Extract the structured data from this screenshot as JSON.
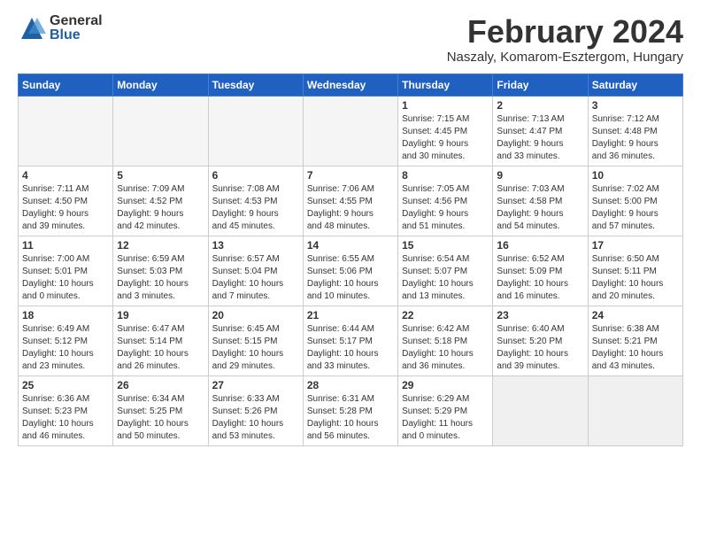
{
  "logo": {
    "general": "General",
    "blue": "Blue"
  },
  "title": "February 2024",
  "subtitle": "Naszaly, Komarom-Esztergom, Hungary",
  "days_header": [
    "Sunday",
    "Monday",
    "Tuesday",
    "Wednesday",
    "Thursday",
    "Friday",
    "Saturday"
  ],
  "weeks": [
    [
      {
        "day": "",
        "info": ""
      },
      {
        "day": "",
        "info": ""
      },
      {
        "day": "",
        "info": ""
      },
      {
        "day": "",
        "info": ""
      },
      {
        "day": "1",
        "info": "Sunrise: 7:15 AM\nSunset: 4:45 PM\nDaylight: 9 hours\nand 30 minutes."
      },
      {
        "day": "2",
        "info": "Sunrise: 7:13 AM\nSunset: 4:47 PM\nDaylight: 9 hours\nand 33 minutes."
      },
      {
        "day": "3",
        "info": "Sunrise: 7:12 AM\nSunset: 4:48 PM\nDaylight: 9 hours\nand 36 minutes."
      }
    ],
    [
      {
        "day": "4",
        "info": "Sunrise: 7:11 AM\nSunset: 4:50 PM\nDaylight: 9 hours\nand 39 minutes."
      },
      {
        "day": "5",
        "info": "Sunrise: 7:09 AM\nSunset: 4:52 PM\nDaylight: 9 hours\nand 42 minutes."
      },
      {
        "day": "6",
        "info": "Sunrise: 7:08 AM\nSunset: 4:53 PM\nDaylight: 9 hours\nand 45 minutes."
      },
      {
        "day": "7",
        "info": "Sunrise: 7:06 AM\nSunset: 4:55 PM\nDaylight: 9 hours\nand 48 minutes."
      },
      {
        "day": "8",
        "info": "Sunrise: 7:05 AM\nSunset: 4:56 PM\nDaylight: 9 hours\nand 51 minutes."
      },
      {
        "day": "9",
        "info": "Sunrise: 7:03 AM\nSunset: 4:58 PM\nDaylight: 9 hours\nand 54 minutes."
      },
      {
        "day": "10",
        "info": "Sunrise: 7:02 AM\nSunset: 5:00 PM\nDaylight: 9 hours\nand 57 minutes."
      }
    ],
    [
      {
        "day": "11",
        "info": "Sunrise: 7:00 AM\nSunset: 5:01 PM\nDaylight: 10 hours\nand 0 minutes."
      },
      {
        "day": "12",
        "info": "Sunrise: 6:59 AM\nSunset: 5:03 PM\nDaylight: 10 hours\nand 3 minutes."
      },
      {
        "day": "13",
        "info": "Sunrise: 6:57 AM\nSunset: 5:04 PM\nDaylight: 10 hours\nand 7 minutes."
      },
      {
        "day": "14",
        "info": "Sunrise: 6:55 AM\nSunset: 5:06 PM\nDaylight: 10 hours\nand 10 minutes."
      },
      {
        "day": "15",
        "info": "Sunrise: 6:54 AM\nSunset: 5:07 PM\nDaylight: 10 hours\nand 13 minutes."
      },
      {
        "day": "16",
        "info": "Sunrise: 6:52 AM\nSunset: 5:09 PM\nDaylight: 10 hours\nand 16 minutes."
      },
      {
        "day": "17",
        "info": "Sunrise: 6:50 AM\nSunset: 5:11 PM\nDaylight: 10 hours\nand 20 minutes."
      }
    ],
    [
      {
        "day": "18",
        "info": "Sunrise: 6:49 AM\nSunset: 5:12 PM\nDaylight: 10 hours\nand 23 minutes."
      },
      {
        "day": "19",
        "info": "Sunrise: 6:47 AM\nSunset: 5:14 PM\nDaylight: 10 hours\nand 26 minutes."
      },
      {
        "day": "20",
        "info": "Sunrise: 6:45 AM\nSunset: 5:15 PM\nDaylight: 10 hours\nand 29 minutes."
      },
      {
        "day": "21",
        "info": "Sunrise: 6:44 AM\nSunset: 5:17 PM\nDaylight: 10 hours\nand 33 minutes."
      },
      {
        "day": "22",
        "info": "Sunrise: 6:42 AM\nSunset: 5:18 PM\nDaylight: 10 hours\nand 36 minutes."
      },
      {
        "day": "23",
        "info": "Sunrise: 6:40 AM\nSunset: 5:20 PM\nDaylight: 10 hours\nand 39 minutes."
      },
      {
        "day": "24",
        "info": "Sunrise: 6:38 AM\nSunset: 5:21 PM\nDaylight: 10 hours\nand 43 minutes."
      }
    ],
    [
      {
        "day": "25",
        "info": "Sunrise: 6:36 AM\nSunset: 5:23 PM\nDaylight: 10 hours\nand 46 minutes."
      },
      {
        "day": "26",
        "info": "Sunrise: 6:34 AM\nSunset: 5:25 PM\nDaylight: 10 hours\nand 50 minutes."
      },
      {
        "day": "27",
        "info": "Sunrise: 6:33 AM\nSunset: 5:26 PM\nDaylight: 10 hours\nand 53 minutes."
      },
      {
        "day": "28",
        "info": "Sunrise: 6:31 AM\nSunset: 5:28 PM\nDaylight: 10 hours\nand 56 minutes."
      },
      {
        "day": "29",
        "info": "Sunrise: 6:29 AM\nSunset: 5:29 PM\nDaylight: 11 hours\nand 0 minutes."
      },
      {
        "day": "",
        "info": ""
      },
      {
        "day": "",
        "info": ""
      }
    ]
  ]
}
